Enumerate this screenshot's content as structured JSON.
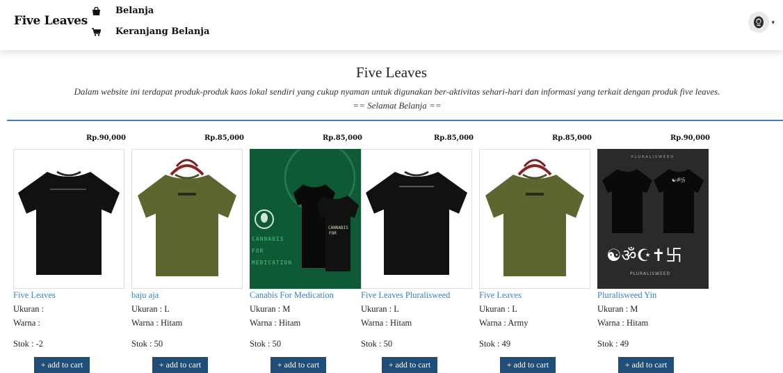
{
  "navbar": {
    "brand": "Five Leaves",
    "items": [
      {
        "label": "Belanja",
        "icon": "shopping-bag-icon"
      },
      {
        "label": "Keranjang Belanja",
        "icon": "shopping-cart-icon"
      }
    ],
    "avatar_icon": "user-avatar-icon"
  },
  "hero": {
    "title": "Five Leaves",
    "description": "Dalam website ini terdapat produk-produk kaos lokal sendiri yang cukup nyaman untuk digunakan ber-aktivitas sehari-hari dan informasi yang terkait dengan produk five leaves.",
    "greeting": "== Selamat Belanja =="
  },
  "products": [
    {
      "price": "Rp.90,000",
      "name": "Five Leaves",
      "size": "Ukuran :",
      "color": "Warna :",
      "stock": "Stok : -2",
      "button": "+ add to cart"
    },
    {
      "price": "Rp.85,000",
      "name": "baju aja",
      "size": "Ukuran : L",
      "color": "Warna : Hitam",
      "stock": "Stok : 50",
      "button": "+ add to cart"
    },
    {
      "price": "Rp.85,000",
      "name": "Canabis For Medication",
      "size": "Ukuran : M",
      "color": "Warna : Hitam",
      "stock": "Stok : 50",
      "button": "+ add to cart"
    },
    {
      "price": "Rp.85,000",
      "name": "Five Leaves Pluralisweed",
      "size": "Ukuran : L",
      "color": "Warna : Hitam",
      "stock": "Stok : 50",
      "button": "+ add to cart"
    },
    {
      "price": "Rp.85,000",
      "name": "Five Leaves",
      "size": "Ukuran : L",
      "color": "Warna : Army",
      "stock": "Stok : 49",
      "button": "+ add to cart"
    },
    {
      "price": "Rp.90,000",
      "name": "Pluralisweed Yin",
      "size": "Ukuran : M",
      "color": "Warna : Hitam",
      "stock": "Stok : 49",
      "button": "+ add to cart"
    }
  ],
  "image_text": {
    "canabis_side": "CANNABIS FOR MEDICATION",
    "plural_top": "PLURALISWEED"
  },
  "colors": {
    "accent": "#3a7fc4",
    "button": "#1f4e79",
    "shirt_black": "#111111",
    "shirt_army": "#5e6630",
    "canabis_bg": "#0f5a36",
    "plural_bg": "#2a2a2a"
  }
}
